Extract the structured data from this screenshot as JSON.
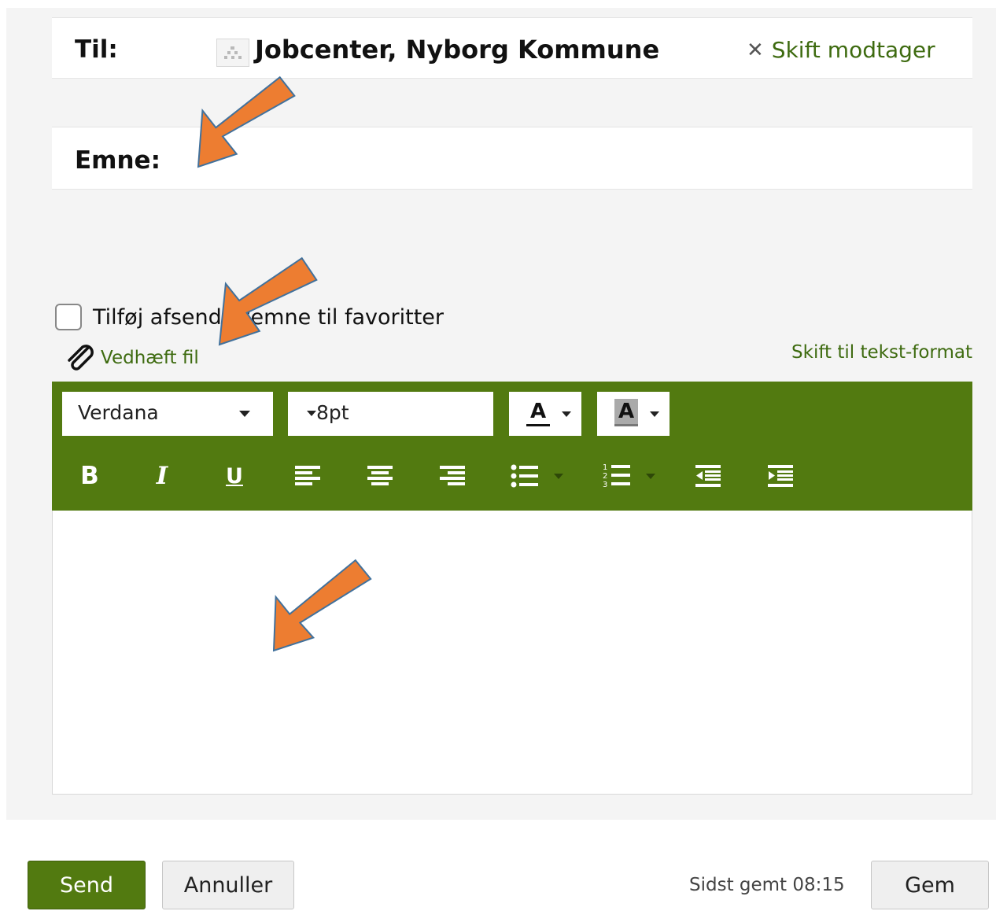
{
  "to": {
    "label": "Til:",
    "recipient": "Jobcenter, Nyborg Kommune",
    "change_label": "Skift modtager"
  },
  "subject": {
    "label": "Emne:",
    "value": ""
  },
  "favorites": {
    "label": "Tilføj afsender/emne til favoritter"
  },
  "attach": {
    "label": "Vedhæft fil"
  },
  "text_format": {
    "label": "Skift til tekst-format"
  },
  "toolbar": {
    "font_family": "Verdana",
    "font_size": "8pt",
    "fg_letter": "A",
    "bg_letter": "A",
    "bold_letter": "B",
    "italic_letter": "I",
    "underline_letter": "U"
  },
  "footer": {
    "send_label": "Send",
    "cancel_label": "Annuller",
    "saved_text": "Sidst gemt 08:15",
    "save_label": "Gem"
  },
  "colors": {
    "accent": "#527a10",
    "link": "#3e6b10",
    "annotation_arrow": "#ed7d31"
  },
  "icons": [
    "recipient-icon",
    "close-icon",
    "paperclip-icon",
    "chevron-down-icon",
    "align-left-icon",
    "align-center-icon",
    "align-right-icon",
    "bulleted-list-icon",
    "numbered-list-icon",
    "outdent-icon",
    "indent-icon"
  ]
}
